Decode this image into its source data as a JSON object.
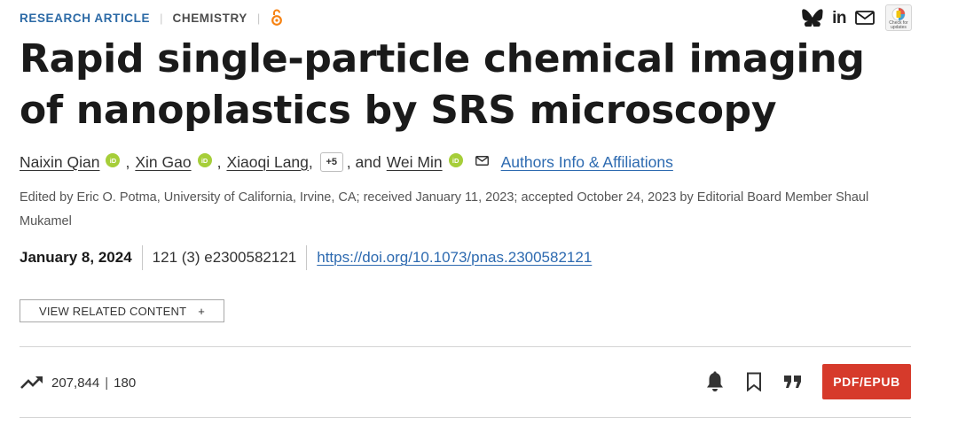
{
  "header": {
    "article_type": "RESEARCH ARTICLE",
    "separator": "|",
    "subject": "CHEMISTRY",
    "crossmark_label": "Check for updates"
  },
  "article": {
    "title": "Rapid single-particle chemical imaging of nanoplastics by SRS microscopy",
    "authors": [
      {
        "name": "Naixin Qian"
      },
      {
        "name": "Xin Gao"
      },
      {
        "name": "Xiaoqi Lang"
      }
    ],
    "more_authors": "+5",
    "and_text": ", and",
    "last_author": "Wei Min",
    "comma": ",",
    "affiliations_link": "Authors Info & Affiliations",
    "orcid_label": "iD",
    "edited_by": "Edited by Eric O. Potma, University of California, Irvine, CA; received January 11, 2023; accepted October 24, 2023 by Editorial Board Member Shaul Mukamel",
    "pub_date": "January 8, 2024",
    "citation": "121 (3) e2300582121",
    "doi_url": "https://doi.org/10.1073/pnas.2300582121"
  },
  "related": {
    "button_label": "VIEW RELATED CONTENT",
    "expand_symbol": "+"
  },
  "metrics": {
    "views": "207,844",
    "separator": "|",
    "citations": "180"
  },
  "actions": {
    "pdf_label": "PDF/EPUB"
  },
  "colors": {
    "accent_blue": "#2c6aa6",
    "link_blue": "#2d6ab0",
    "pdf_red": "#d63a2b",
    "orcid_green": "#a6ce39",
    "open_access_orange": "#f68212"
  },
  "icons": [
    "open-access-icon",
    "bluesky-icon",
    "linkedin-icon",
    "email-icon",
    "crossmark-icon",
    "orcid-icon",
    "trend-icon",
    "bell-icon",
    "bookmark-icon",
    "cite-icon"
  ]
}
